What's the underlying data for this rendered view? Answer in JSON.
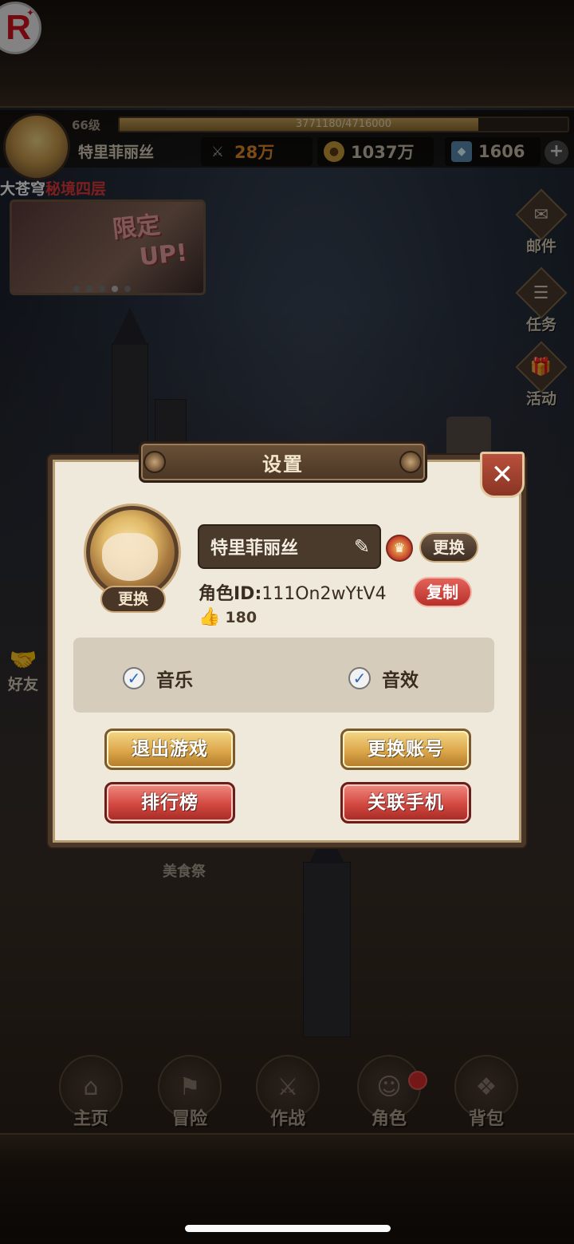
{
  "colors": {
    "accent_gold": "#dca64a",
    "accent_red": "#d24840",
    "dialog_bg": "#efe9dc",
    "red_text": "#e33a3a"
  },
  "hud": {
    "level": "66级",
    "exp_text": "3771180/4716000",
    "exp_fraction": 0.8,
    "player_name": "特里菲丽丝",
    "power": "28万",
    "gold": "1037万",
    "gems": "1606",
    "plus": "+",
    "progress_prefix": "大苍穹",
    "progress_stage": "秘境四层"
  },
  "banner": {
    "text_line1": "限定",
    "text_line2": "UP!"
  },
  "side_menu": [
    {
      "label": "邮件",
      "icon": "mail-icon"
    },
    {
      "label": "任务",
      "icon": "task-icon"
    },
    {
      "label": "活动",
      "icon": "gift-icon"
    }
  ],
  "friend": {
    "label": "好友",
    "icon": "handshake-icon"
  },
  "map_label": "美食祭",
  "bottom_nav": [
    {
      "label": "主页"
    },
    {
      "label": "冒险"
    },
    {
      "label": "作战"
    },
    {
      "label": "角色"
    },
    {
      "label": "背包"
    }
  ],
  "dialog": {
    "title": "设置",
    "close": "✕",
    "avatar_change": "更换",
    "name": "特里菲丽丝",
    "title_change": "更换",
    "role_id_label": "角色ID:",
    "role_id_value": "111On2wYtV4",
    "copy": "复制",
    "likes": "180",
    "music_label": "音乐",
    "sfx_label": "音效",
    "music_on": true,
    "sfx_on": true,
    "exit_game": "退出游戏",
    "switch_account": "更换账号",
    "leaderboard": "排行榜",
    "link_phone": "关联手机"
  }
}
